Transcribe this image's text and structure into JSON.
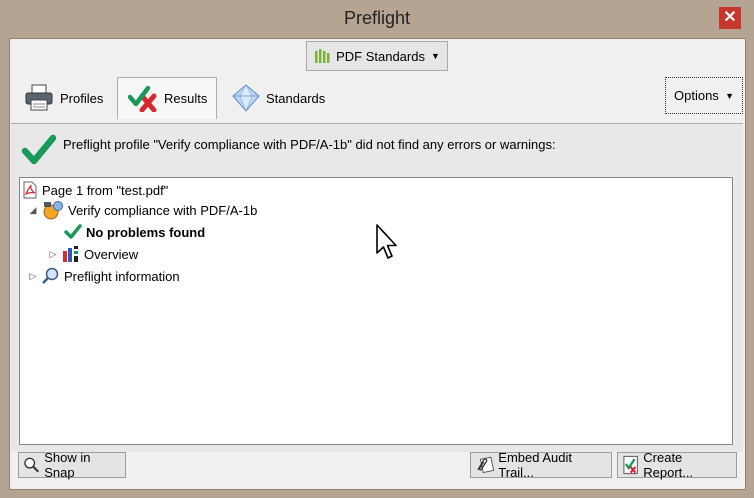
{
  "window": {
    "title": "Preflight",
    "close_glyph": "✕"
  },
  "toolbar": {
    "dropdown_label": "PDF Standards",
    "dropdown_icon": "bars-icon"
  },
  "tabs": [
    {
      "label": "Profiles",
      "icon": "printer-icon",
      "active": false
    },
    {
      "label": "Results",
      "icon": "check-cross-icon",
      "active": true
    },
    {
      "label": "Standards",
      "icon": "diamond-icon",
      "active": false
    }
  ],
  "options": {
    "label": "Options"
  },
  "results": {
    "summary": "Preflight profile \"Verify compliance with PDF/A-1b\" did not find any errors or warnings:",
    "tree": {
      "page": "Page 1 from \"test.pdf\"",
      "profile": "Verify compliance with PDF/A-1b",
      "status": "No problems found",
      "overview": "Overview",
      "info": "Preflight information"
    }
  },
  "buttons": {
    "show_in_snap": "Show in Snap",
    "embed_audit": "Embed Audit Trail...",
    "create_report": "Create Report..."
  },
  "colors": {
    "success": "#1a9a5a",
    "error": "#d6282e",
    "frame": "#b6a493",
    "close": "#c8372d"
  }
}
